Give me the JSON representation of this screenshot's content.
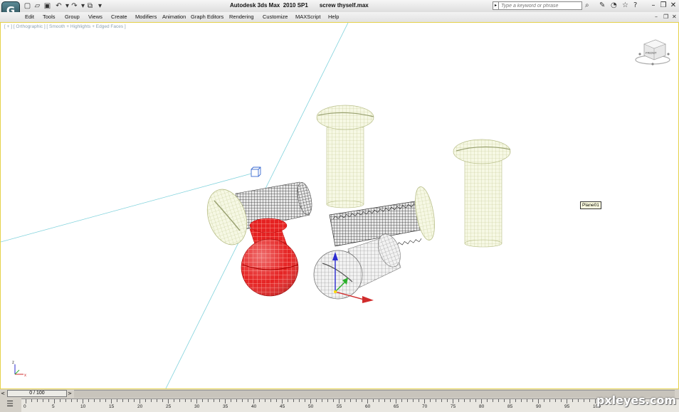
{
  "app": {
    "title": "Autodesk 3ds Max  2010 SP1",
    "file": "screw thyself.max",
    "logo_glyph": "G"
  },
  "quick_access": [
    {
      "name": "new-file-icon",
      "glyph": "▢"
    },
    {
      "name": "open-file-icon",
      "glyph": "▱"
    },
    {
      "name": "save-icon",
      "glyph": "▣"
    },
    {
      "name": "undo-icon",
      "glyph": "↶"
    },
    {
      "name": "undo-dropdown-icon",
      "glyph": "▾"
    },
    {
      "name": "redo-icon",
      "glyph": "↷"
    },
    {
      "name": "redo-dropdown-icon",
      "glyph": "▾"
    },
    {
      "name": "project-folder-icon",
      "glyph": "⧉"
    },
    {
      "name": "quick-access-dropdown-icon",
      "glyph": "▾"
    }
  ],
  "search": {
    "placeholder": "Type a keyword or phrase"
  },
  "info_tools": [
    {
      "name": "binoculars-icon",
      "glyph": "⌕"
    },
    {
      "name": "tools-icon",
      "glyph": "✎"
    },
    {
      "name": "communication-icon",
      "glyph": "◔"
    },
    {
      "name": "favorites-star-icon",
      "glyph": "☆"
    },
    {
      "name": "help-icon",
      "glyph": "?"
    }
  ],
  "window_buttons": [
    {
      "name": "minimize-icon",
      "glyph": "–"
    },
    {
      "name": "restore-icon",
      "glyph": "❐"
    },
    {
      "name": "close-icon",
      "glyph": "✕"
    }
  ],
  "menu": [
    "Edit",
    "Tools",
    "Group",
    "Views",
    "Create",
    "Modifiers",
    "Animation",
    "Graph Editors",
    "Rendering",
    "Customize",
    "MAXScript",
    "Help"
  ],
  "mdi_buttons": [
    {
      "name": "mdi-minimize-icon",
      "glyph": "–"
    },
    {
      "name": "mdi-restore-icon",
      "glyph": "❐"
    },
    {
      "name": "mdi-close-icon",
      "glyph": "✕"
    }
  ],
  "viewport": {
    "label": "[ + ] [ Orthographic ] [ Smooth + Highlights + Edged Faces ]",
    "viewcube_face": "FRONT",
    "tooltip": "Plane01",
    "axis_labels": {
      "z": "z",
      "x": "x"
    }
  },
  "time_slider": {
    "value": "0 / 100",
    "left_glyph": "<",
    "right_glyph": ">"
  },
  "track_bar": {
    "labels": [
      "0",
      "5",
      "10",
      "15",
      "20",
      "25",
      "30",
      "35",
      "40",
      "45",
      "50",
      "55",
      "60",
      "65",
      "70",
      "75",
      "80",
      "85",
      "90",
      "95",
      "100"
    ],
    "key_glyph": "☰"
  },
  "watermark": "pxleyes.com",
  "colors": {
    "viewport_border": "#e6d24a",
    "red_head": "#e02020",
    "screw_fill": "#f4f7dc",
    "screw_wire": "#c9cf9e",
    "grid_line": "#7fd2dc"
  }
}
